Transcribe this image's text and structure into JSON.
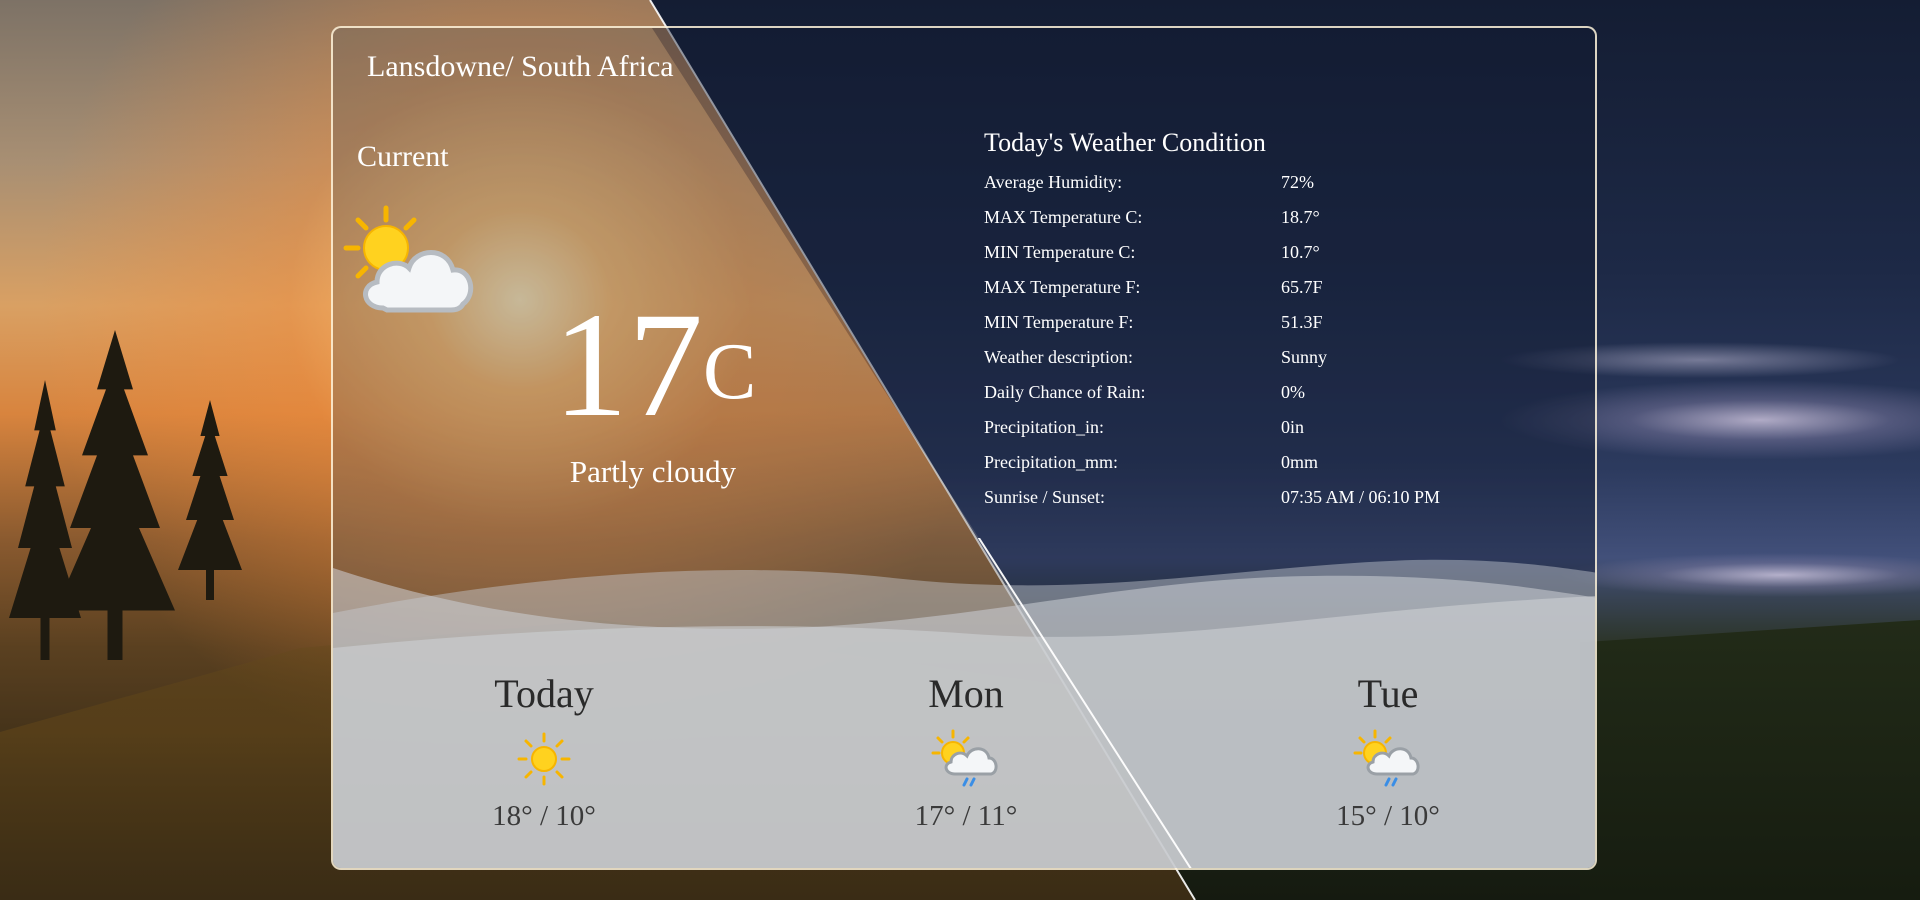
{
  "location": "Lansdowne/ South Africa",
  "current": {
    "label": "Current",
    "icon": "partly-cloudy-icon",
    "temperature": "17",
    "unit": "C",
    "condition": "Partly cloudy"
  },
  "today_conditions": {
    "title": "Today's Weather Condition",
    "rows": [
      {
        "label": "Average Humidity:",
        "value": "72%"
      },
      {
        "label": "MAX Temperature C:",
        "value": "18.7°"
      },
      {
        "label": "MIN Temperature C:",
        "value": "10.7°"
      },
      {
        "label": "MAX Temperature F:",
        "value": "65.7F"
      },
      {
        "label": "MIN Temperature F:",
        "value": "51.3F"
      },
      {
        "label": "Weather description:",
        "value": "Sunny"
      },
      {
        "label": "Daily Chance of Rain:",
        "value": "0%"
      },
      {
        "label": "Precipitation_in:",
        "value": "0in"
      },
      {
        "label": "Precipitation_mm:",
        "value": "0mm"
      },
      {
        "label": "Sunrise / Sunset:",
        "value": "07:35 AM / 06:10 PM"
      }
    ]
  },
  "forecast": [
    {
      "day": "Today",
      "icon": "sun-icon",
      "temps": "18° / 10°"
    },
    {
      "day": "Mon",
      "icon": "sun-cloud-rain-icon",
      "temps": "17° / 11°"
    },
    {
      "day": "Tue",
      "icon": "sun-cloud-rain-icon",
      "temps": "15° / 10°"
    }
  ],
  "colors": {
    "text_light": "#ffffff",
    "text_dark": "#2a2a2a",
    "card_border": "#fff5dc",
    "sun": "#ffd21f",
    "rain": "#3a8ee6"
  }
}
